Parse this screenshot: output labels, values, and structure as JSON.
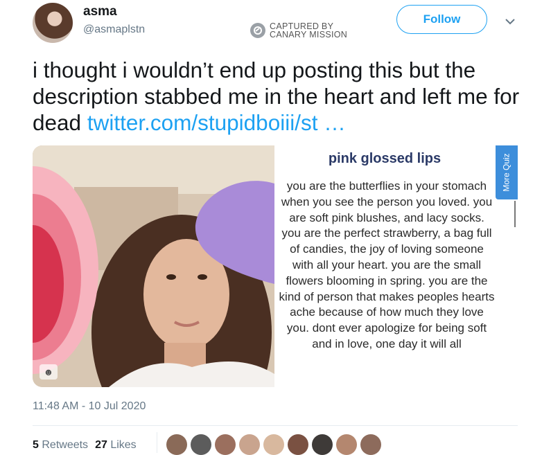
{
  "author": {
    "display_name": "asma",
    "handle": "@asmaplstn",
    "follow_label": "Follow"
  },
  "watermark": {
    "line1": "CAPTURED BY",
    "line2": "CANARY MISSION"
  },
  "tweet": {
    "text": "i thought i wouldn’t end up posting this but the description stabbed me in the heart and left me for dead ",
    "link": "twitter.com/stupidboiii/st …",
    "timestamp": "11:48 AM - 10 Jul 2020"
  },
  "quiz_card": {
    "title": "pink glossed lips",
    "body": "you are the butterflies in your stomach when you see the person you loved. you are soft pink blushes, and lacy socks. you are the perfect strawberry, a bag full of candies, the joy of loving someone with all your heart. you are the small flowers blooming in spring. you are the kind of person that makes peoples hearts ache because of how much they love you. dont ever apologize for being soft and in love, one day it will all",
    "more_label": "More Quiz"
  },
  "stats": {
    "retweets_count": "5",
    "retweets_label": "Retweets",
    "likes_count": "27",
    "likes_label": "Likes"
  },
  "colors": {
    "accent": "#1da1f2",
    "heart_pink": "#f29aa8",
    "heart_purple": "#a98bd8"
  }
}
